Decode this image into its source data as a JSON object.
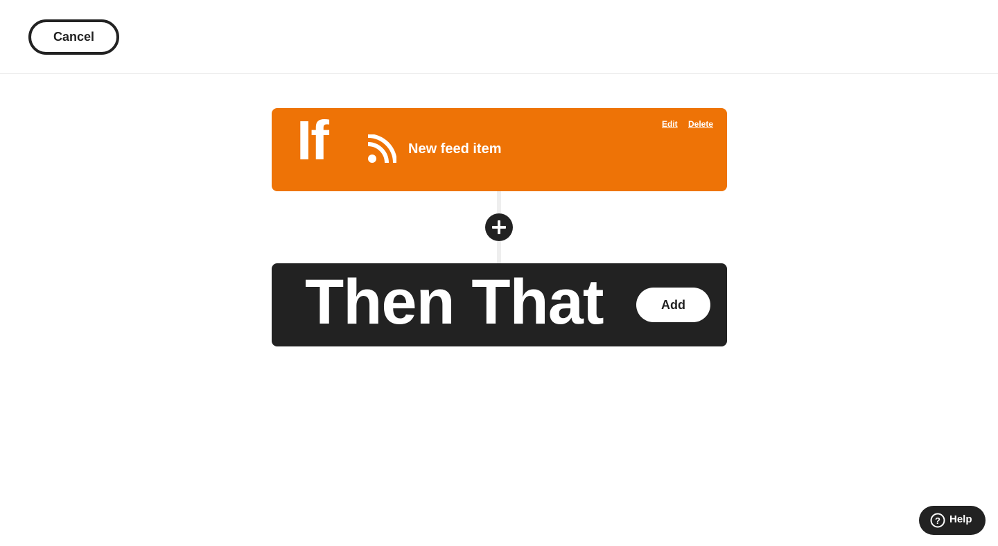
{
  "header": {
    "cancel_label": "Cancel"
  },
  "trigger": {
    "keyword": "If",
    "service_icon": "rss-icon",
    "label": "New feed item",
    "edit_label": "Edit",
    "delete_label": "Delete",
    "color": "#ee7306"
  },
  "connector": {
    "add_step_icon": "plus-icon"
  },
  "action": {
    "keyword": "Then That",
    "add_label": "Add",
    "color": "#222222"
  },
  "help": {
    "icon": "question-circle-icon",
    "label": "Help"
  }
}
